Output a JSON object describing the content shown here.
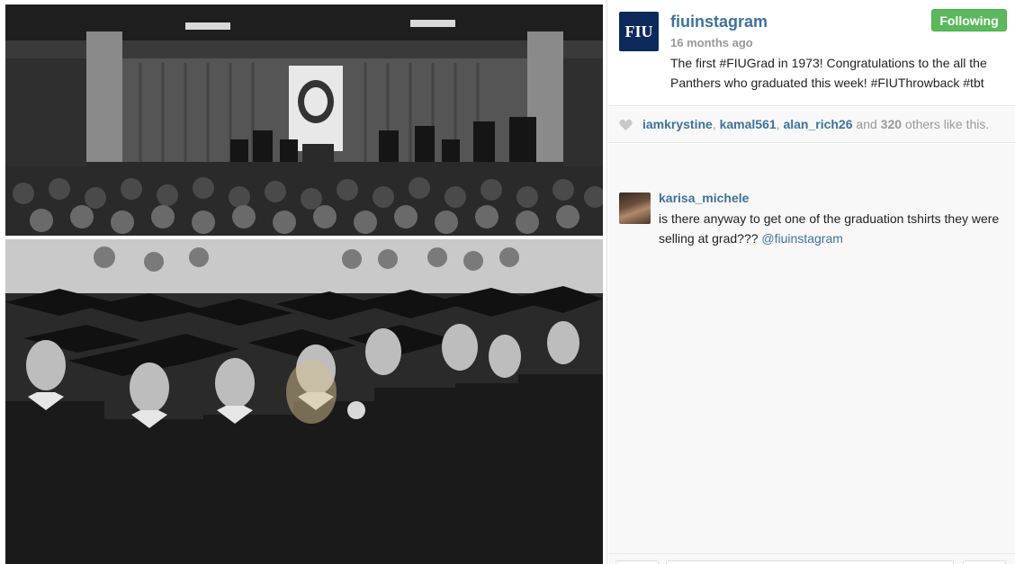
{
  "post": {
    "username": "fiuinstagram",
    "avatar_text": "FIU",
    "time_ago": "16 months ago",
    "follow_label": "Following",
    "caption": "The first #FIUGrad in 1973! Congratulations to the all the Panthers who graduated this week! #FIUThrowback #tbt"
  },
  "likes": {
    "users": [
      "iamkrystine",
      "kamal561",
      "alan_rich26"
    ],
    "separator": ", ",
    "and_text": " and ",
    "others_count": "320",
    "others_text": " others like this."
  },
  "comments": [
    {
      "username": "karisa_michele",
      "text": "is there anyway to get one of the graduation tshirts they were selling at grad??? ",
      "mention": "@fiuinstagram"
    }
  ],
  "photos": {
    "top_alt": "Stage with speakers and graduates at podium",
    "bottom_alt": "Seated graduates in caps and gowns"
  },
  "colors": {
    "link": "#3f729b",
    "follow_bg": "#5cb85c",
    "muted": "#999999",
    "avatar_bg": "#0e2a5c"
  }
}
